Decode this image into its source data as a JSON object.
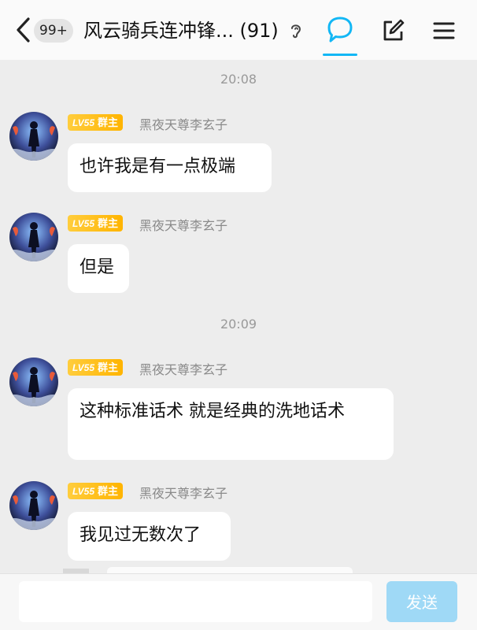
{
  "header": {
    "unread_badge": "99+",
    "group_title": "风云骑兵连冲锋... (91)",
    "icons": [
      "back-arrow-icon",
      "ear-icon",
      "chat-bubble-icon",
      "edit-icon",
      "menu-icon"
    ],
    "accent_color": "#12b7f5"
  },
  "messages": [
    {
      "time": "20:08"
    },
    {
      "level": "LV55",
      "role": "群主",
      "sender": "黑夜天尊李玄子",
      "text": "也许我是有一点极端"
    },
    {
      "level": "LV55",
      "role": "群主",
      "sender": "黑夜天尊李玄子",
      "text": "但是"
    },
    {
      "time": "20:09"
    },
    {
      "level": "LV55",
      "role": "群主",
      "sender": "黑夜天尊李玄子",
      "text": "这种标准话术 就是经典的洗地话术"
    },
    {
      "level": "LV55",
      "role": "群主",
      "sender": "黑夜天尊李玄子",
      "text": "我见过无数次了"
    }
  ],
  "input": {
    "value": "",
    "send_label": "发送"
  }
}
